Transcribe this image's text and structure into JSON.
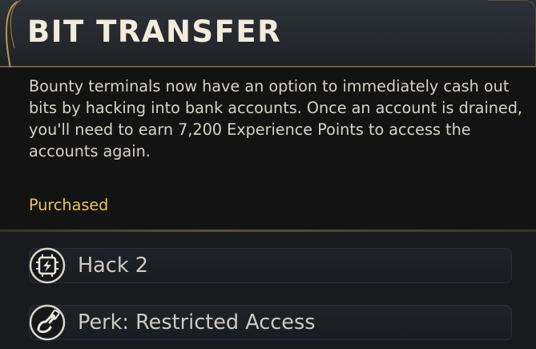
{
  "header": {
    "title": "BIT TRANSFER"
  },
  "description": "Bounty terminals now have an option to immediately cash out bits by hacking into bank accounts. Once an account is drained, you'll need to earn 7,200 Experience Points to access the accounts again.",
  "status": {
    "label": "Purchased",
    "color": "#e8c35a"
  },
  "requirements": [
    {
      "label": "Hack 2",
      "icon": "hack-chip-icon"
    },
    {
      "label": "Perk: Restricted Access",
      "icon": "perk-hand-icon"
    }
  ],
  "colors": {
    "accent_gold": "#e8c35a",
    "title_text": "#f3ecdc",
    "body_text": "#d7d3c6"
  }
}
